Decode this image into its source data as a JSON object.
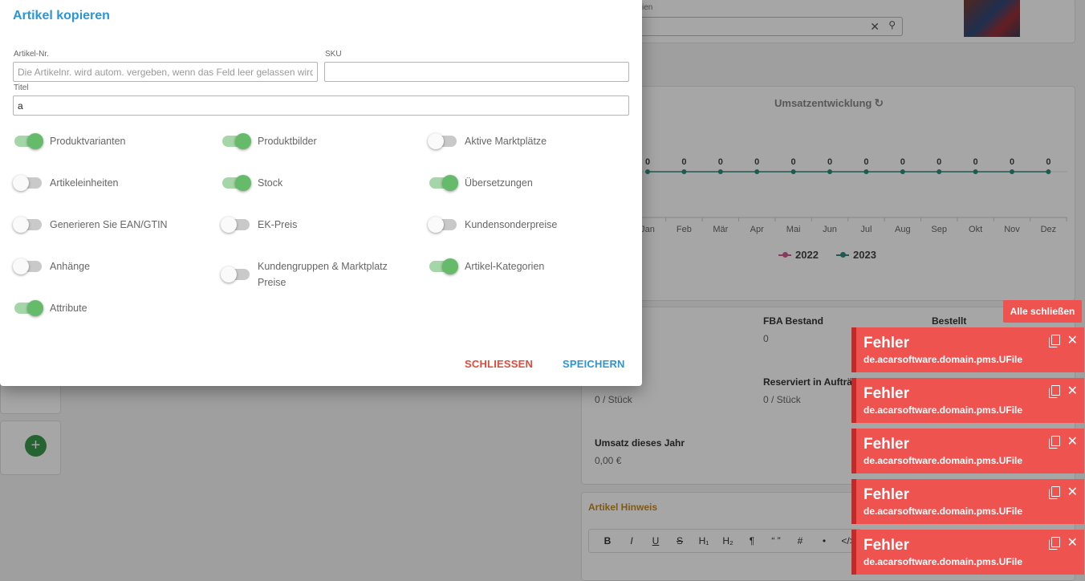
{
  "background": {
    "search_label": "ien",
    "chart": {
      "title": "Umsatzentwicklung",
      "refresh_icon": "refresh-icon"
    },
    "stats": {
      "fba_label": "FBA Bestand",
      "fba_value": "0",
      "ordered_label": "Bestellt",
      "reserved_label": "Reserviert in Aufträ",
      "reserved_value": "0 / Stück",
      "left_value": "0 / Stück",
      "revenue_label": "Umsatz dieses Jahr",
      "revenue_value": "0,00 €"
    },
    "hint_title": "Artikel Hinweis",
    "editor_buttons": [
      "B",
      "I",
      "U",
      "S",
      "H₁",
      "H₂",
      "¶",
      "“ ”",
      "#",
      "•",
      "</>"
    ],
    "add_icon": "plus-icon",
    "add_symbol": "+"
  },
  "chart_data": {
    "type": "line",
    "title": "Umsatzentwicklung",
    "categories": [
      "Jan",
      "Feb",
      "Mär",
      "Apr",
      "Mai",
      "Jun",
      "Jul",
      "Aug",
      "Sep",
      "Okt",
      "Nov",
      "Dez"
    ],
    "series": [
      {
        "name": "2022",
        "values": [
          0,
          0,
          0,
          0,
          0,
          0,
          0,
          0,
          0,
          0,
          0,
          0
        ],
        "color": "#d15b8f"
      },
      {
        "name": "2023",
        "values": [
          0,
          0,
          0,
          0,
          0,
          0,
          0,
          0,
          0,
          0,
          0,
          0
        ],
        "color": "#2e8b7a"
      }
    ],
    "data_labels": [
      "0",
      "0",
      "0",
      "0",
      "0",
      "0",
      "0",
      "0",
      "0",
      "0",
      "0",
      "0"
    ],
    "legend": "bottom"
  },
  "modal": {
    "title": "Artikel kopieren",
    "article_nr_label": "Artikel-Nr.",
    "article_nr_placeholder": "Die Artikelnr. wird autom. vergeben, wenn das Feld leer gelassen wird",
    "article_nr_value": "",
    "sku_label": "SKU",
    "sku_value": "",
    "title_label": "Titel",
    "title_value": "a",
    "toggles": [
      {
        "label": "Produktvarianten",
        "on": true
      },
      {
        "label": "Produktbilder",
        "on": true
      },
      {
        "label": "Aktive Marktplätze",
        "on": false
      },
      {
        "label": "Artikeleinheiten",
        "on": false
      },
      {
        "label": "Stock",
        "on": true
      },
      {
        "label": "Übersetzungen",
        "on": true
      },
      {
        "label": "Generieren Sie EAN/GTIN",
        "on": false
      },
      {
        "label": "EK-Preis",
        "on": false
      },
      {
        "label": "Kundensonderpreise",
        "on": false
      },
      {
        "label": "Anhänge",
        "on": false
      },
      {
        "label": "Kundengruppen & Marktplatz Preise",
        "on": false
      },
      {
        "label": "Artikel-Kategorien",
        "on": true
      },
      {
        "label": "Attribute",
        "on": true
      }
    ],
    "close_label": "SCHLIESSEN",
    "save_label": "SPEICHERN"
  },
  "toasts": {
    "close_all_label": "Alle schließen",
    "items": [
      {
        "title": "Fehler",
        "message": "de.acarsoftware.domain.pms.UFile"
      },
      {
        "title": "Fehler",
        "message": "de.acarsoftware.domain.pms.UFile"
      },
      {
        "title": "Fehler",
        "message": "de.acarsoftware.domain.pms.UFile"
      },
      {
        "title": "Fehler",
        "message": "de.acarsoftware.domain.pms.UFile"
      },
      {
        "title": "Fehler",
        "message": "de.acarsoftware.domain.pms.UFile"
      }
    ],
    "copy_icon": "copy-icon",
    "close_icon": "close-icon",
    "close_symbol": "✕"
  }
}
